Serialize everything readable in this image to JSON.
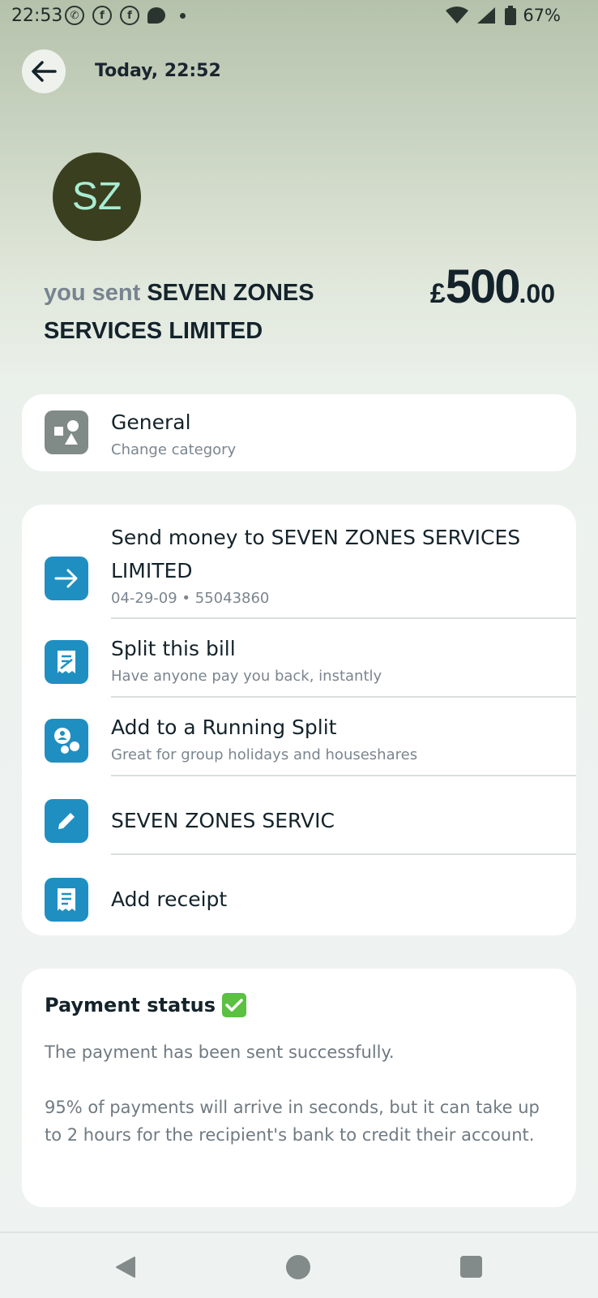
{
  "status_bar": {
    "time": "22:53",
    "battery": "67%",
    "icons": [
      "whatsapp-icon",
      "facebook-icon",
      "facebook-icon",
      "chat-icon",
      "wifi-icon",
      "signal-icon",
      "battery-icon"
    ]
  },
  "header": {
    "datetime": "Today, 22:52"
  },
  "avatar": {
    "initials": "SZ",
    "bg_color": "#3a3f1f",
    "text_color": "#a8edd2"
  },
  "transaction": {
    "prefix": "you sent",
    "recipient": "SEVEN ZONES SERVICES LIMITED",
    "currency": "£",
    "amount_major": "500",
    "amount_minor": ".00"
  },
  "category": {
    "title": "General",
    "subtitle": "Change category"
  },
  "actions": [
    {
      "title": "Send money to SEVEN ZONES SERVICES LIMITED",
      "subtitle": "04-29-09 • 55043860",
      "icon": "arrow-right-icon"
    },
    {
      "title": "Split this bill",
      "subtitle": "Have anyone pay you back, instantly",
      "icon": "split-bill-icon"
    },
    {
      "title": "Add to a Running Split",
      "subtitle": "Great for group holidays and houseshares",
      "icon": "group-icon"
    },
    {
      "title": "SEVEN ZONES SERVIC",
      "subtitle": "",
      "icon": "pencil-icon"
    },
    {
      "title": "Add receipt",
      "subtitle": "",
      "icon": "receipt-icon"
    }
  ],
  "payment_status": {
    "title": "Payment status",
    "line1": "The payment has been sent successfully.",
    "line2": "95% of payments will arrive in seconds, but it can take up to 2 hours for the recipient's bank to credit their account."
  },
  "colors": {
    "accent_blue": "#1f8fc2",
    "category_grey": "#808a86",
    "success_green": "#5cc043"
  }
}
